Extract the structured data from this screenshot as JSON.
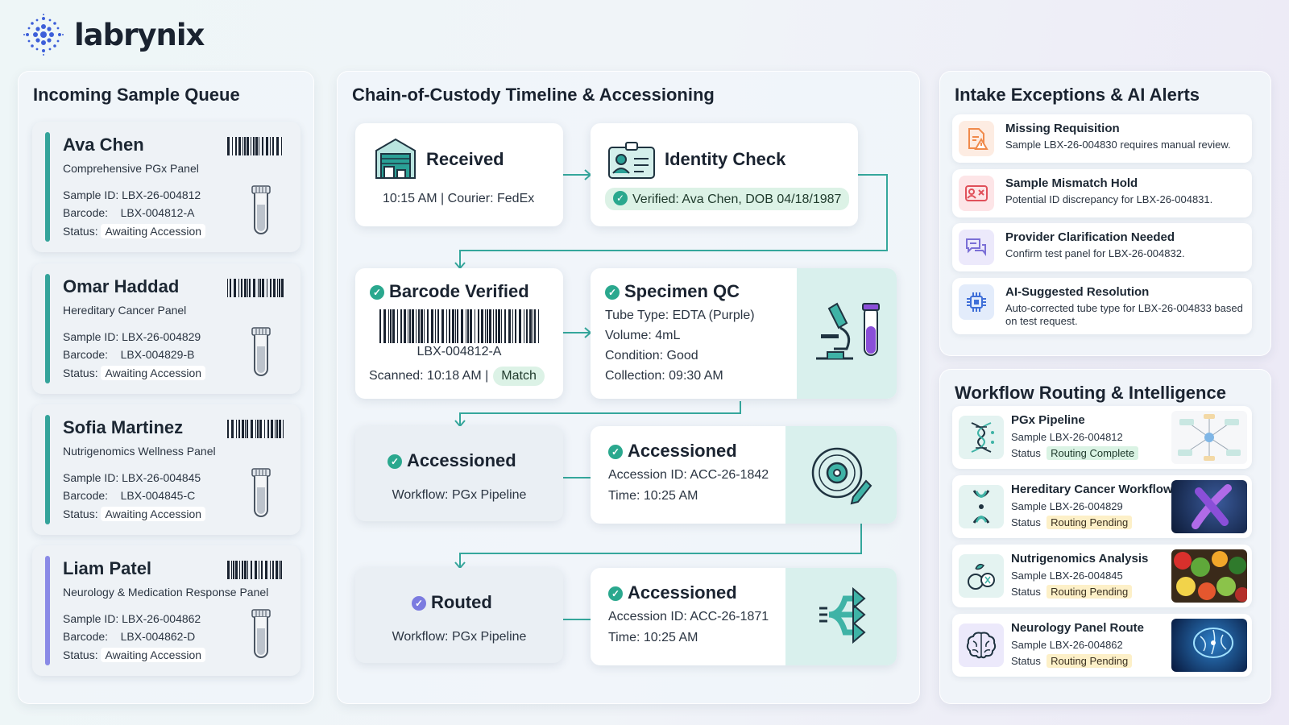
{
  "brand": {
    "name": "labrynix",
    "accent": "#34a39a"
  },
  "queue": {
    "title": "Incoming Sample Queue",
    "cards": [
      {
        "name": "Ava Chen",
        "panel": "Comprehensive PGx Panel",
        "sample_id": "Sample ID: LBX-26-004812",
        "barcode_label": "Barcode:",
        "barcode": "LBX-004812-A",
        "status_label": "Status:",
        "status": "Awaiting Accession",
        "bar_color": "#34a39a"
      },
      {
        "name": "Omar Haddad",
        "panel": "Hereditary Cancer Panel",
        "sample_id": "Sample ID: LBX-26-004829",
        "barcode_label": "Barcode:",
        "barcode": "LBX-004829-B",
        "status_label": "Status:",
        "status": "Awaiting Accession",
        "bar_color": "#34a39a"
      },
      {
        "name": "Sofia Martinez",
        "panel": "Nutrigenomics Wellness Panel",
        "sample_id": "Sample ID: LBX-26-004845",
        "barcode_label": "Barcode:",
        "barcode": "LBX-004845-C",
        "status_label": "Status:",
        "status": "Awaiting Accession",
        "bar_color": "#34a39a"
      },
      {
        "name": "Liam Patel",
        "panel": "Neurology & Medication Response Panel",
        "sample_id": "Sample ID: LBX-26-004862",
        "barcode_label": "Barcode:",
        "barcode": "LBX-004862-D",
        "status_label": "Status:",
        "status": "Awaiting Accession",
        "bar_color": "#8a8ae6"
      }
    ]
  },
  "timeline": {
    "title": "Chain-of-Custody Timeline & Accessioning",
    "received": {
      "title": "Received",
      "detail": "10:15 AM | Courier: FedEx"
    },
    "identity": {
      "title": "Identity Check",
      "verified": "Verified: Ava Chen, DOB 04/18/1987"
    },
    "barcode": {
      "title": "Barcode Verified",
      "code": "LBX-004812-A",
      "scanned": "Scanned: 10:18 AM |",
      "match": "Match"
    },
    "qc": {
      "title": "Specimen QC",
      "tube": "Tube Type: EDTA (Purple)",
      "volume": "Volume: 4mL",
      "condition": "Condition: Good",
      "collection": "Collection: 09:30 AM"
    },
    "accessioned_left": {
      "title": "Accessioned",
      "workflow": "Workflow: PGx Pipeline"
    },
    "accessioned_right_1": {
      "title": "Accessioned",
      "id": "Accession ID: ACC-26-1842",
      "time": "Time: 10:25 AM"
    },
    "routed": {
      "title": "Routed",
      "workflow": "Workflow: PGx Pipeline"
    },
    "accessioned_right_2": {
      "title": "Accessioned",
      "id": "Accession ID: ACC-26-1871",
      "time": "Time: 10:25 AM"
    }
  },
  "exceptions": {
    "title": "Intake Exceptions & AI Alerts",
    "items": [
      {
        "title": "Missing Requisition",
        "desc": "Sample LBX-26-004830 requires manual review.",
        "icon": "document-warning-icon",
        "color": "#f08a4b"
      },
      {
        "title": "Sample Mismatch Hold",
        "desc": "Potential ID discrepancy for LBX-26-004831.",
        "icon": "id-mismatch-icon",
        "color": "#e0505a"
      },
      {
        "title": "Provider Clarification Needed",
        "desc": "Confirm test panel for LBX-26-004832.",
        "icon": "chat-bubbles-icon",
        "color": "#7b6fd6"
      },
      {
        "title": "AI-Suggested Resolution",
        "desc": "Auto-corrected tube type for LBX-26-004833 based on test request.",
        "icon": "chip-icon",
        "color": "#3f6fd8"
      }
    ]
  },
  "routing": {
    "title": "Workflow Routing & Intelligence",
    "items": [
      {
        "title": "PGx Pipeline",
        "sample": "Sample LBX-26-004812",
        "status_label": "Status",
        "status": "Routing Complete",
        "state": "complete",
        "icon": "dna-icon"
      },
      {
        "title": "Hereditary Cancer Workflow",
        "sample": "Sample LBX-26-004829",
        "status_label": "Status",
        "status": "Routing Pending",
        "state": "pending",
        "icon": "chromosome-icon"
      },
      {
        "title": "Nutrigenomics Analysis",
        "sample": "Sample LBX-26-004845",
        "status_label": "Status",
        "status": "Routing Pending",
        "state": "pending",
        "icon": "nutrition-icon"
      },
      {
        "title": "Neurology Panel Route",
        "sample": "Sample LBX-26-004862",
        "status_label": "Status",
        "status": "Routing Pending",
        "state": "pending",
        "icon": "brain-icon"
      }
    ]
  }
}
